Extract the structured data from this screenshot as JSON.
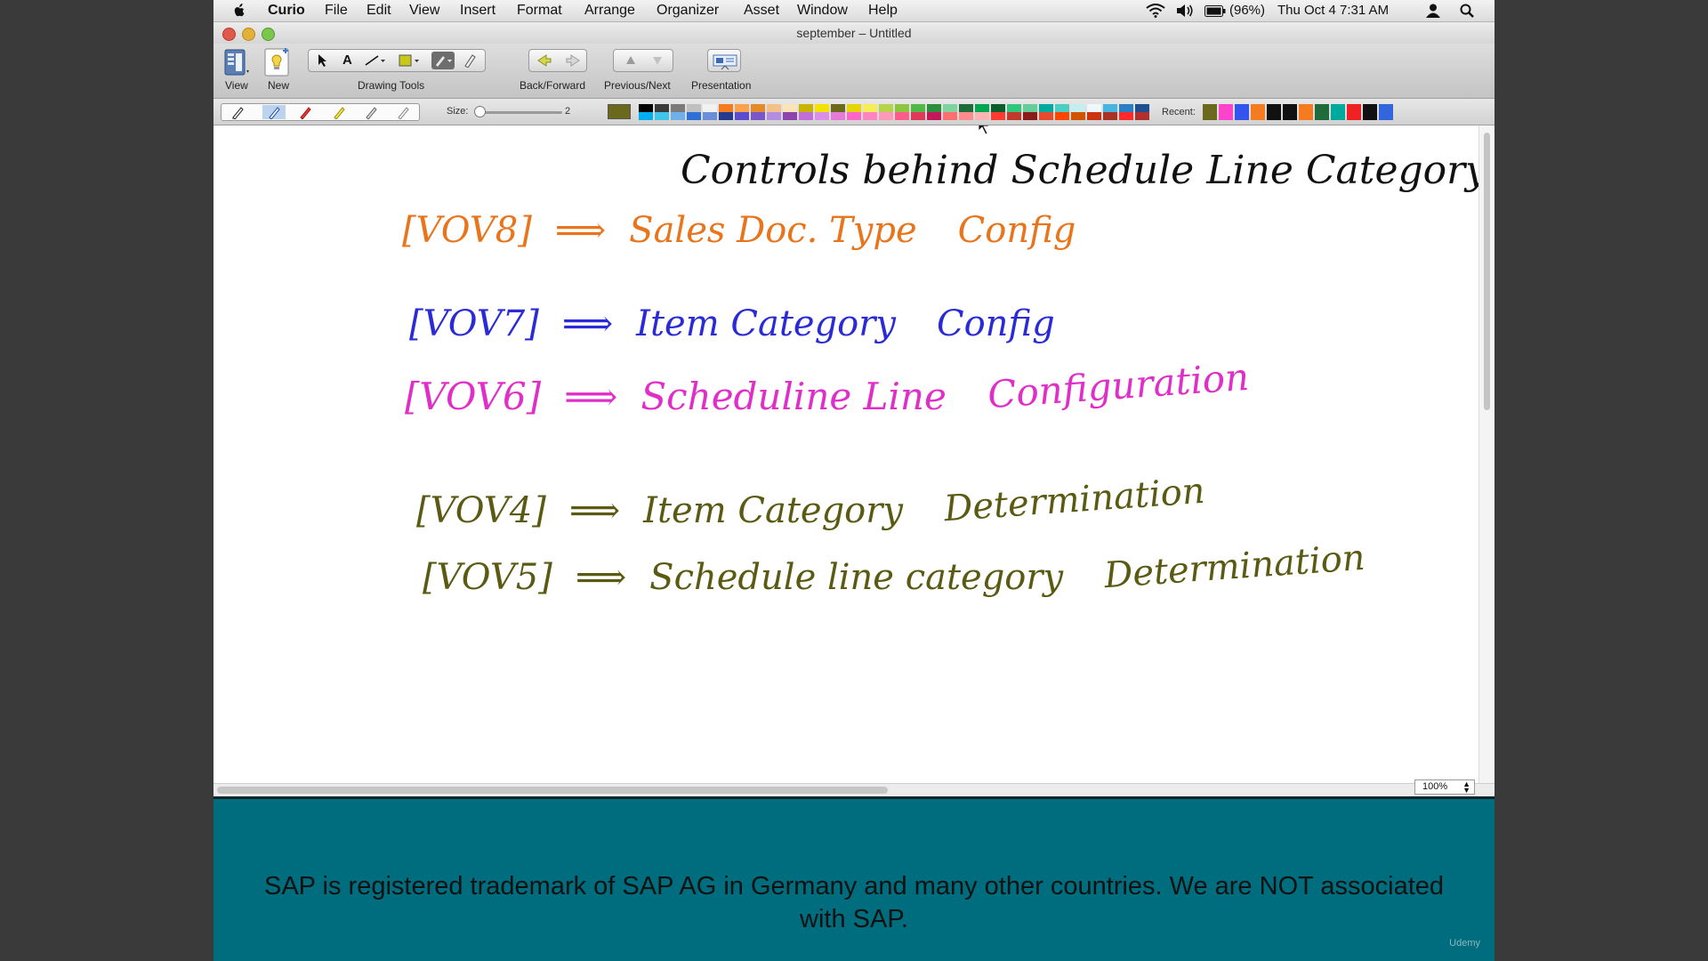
{
  "menubar": {
    "app_name": "Curio",
    "items": [
      "File",
      "Edit",
      "View",
      "Insert",
      "Format",
      "Arrange",
      "Organizer",
      "Asset",
      "Window",
      "Help"
    ],
    "battery": "(96%)",
    "clock": "Thu Oct 4  7:31 AM"
  },
  "window": {
    "title": "september – Untitled"
  },
  "toolbar": {
    "view_label": "View",
    "new_label": "New",
    "drawing_tools_label": "Drawing Tools",
    "back_forward_label": "Back/Forward",
    "previous_next_label": "Previous/Next",
    "presentation_label": "Presentation",
    "text_tool_glyph": "A"
  },
  "palette": {
    "size_label": "Size:",
    "size_value": "2",
    "recent_label": "Recent:",
    "current_color": "#6b6a1c",
    "colors_top": [
      "#000000",
      "#3a3a3a",
      "#7a7a7a",
      "#c0c0c0",
      "#f2f2f2",
      "#f47b20",
      "#f9a24c",
      "#e38a2a",
      "#f4c089",
      "#fde4b8",
      "#c8b400",
      "#f2e200",
      "#6b6a1c",
      "#e6d600",
      "#f5ee59",
      "#b5d44c",
      "#8cc63f",
      "#52b848",
      "#2d8f3a",
      "#7fd3a0",
      "#1f6b3a",
      "#00a651",
      "#0b5d2c",
      "#30c67c",
      "#66cc99",
      "#00a99d",
      "#4ecdc4",
      "#c6eef0",
      "#f0f8ff",
      "#47b5e0",
      "#2b7ec1",
      "#1f4f8f"
    ],
    "colors_bottom": [
      "#00aeef",
      "#40c4ea",
      "#6fb0e8",
      "#2e6fd8",
      "#6a8fd6",
      "#233a8f",
      "#5a4bd1",
      "#7a57c8",
      "#b48ce0",
      "#8e44ad",
      "#c06fd8",
      "#d98fe8",
      "#e57ad8",
      "#ff66cc",
      "#ff85c0",
      "#ff99bb",
      "#ff5c8a",
      "#e03a5a",
      "#c2185b",
      "#ff6f6f",
      "#ff8c8c",
      "#ffb3b3",
      "#ff3b30",
      "#c0392b",
      "#8b1a1a",
      "#e84a2f",
      "#ff4500",
      "#d35400",
      "#cc3311",
      "#a93226",
      "#ff2a2a",
      "#b03030"
    ],
    "recent_colors": [
      "#6b6a1c",
      "#ff44cc",
      "#3355ee",
      "#f47b20",
      "#111111",
      "#111111",
      "#f47b20",
      "#1f6b3a",
      "#00a99d",
      "#ee2222",
      "#111111",
      "#3366dd"
    ]
  },
  "canvas": {
    "title": "Controls behind Schedule Line Category",
    "rows": [
      {
        "code": "[VOV8]",
        "arrow": "⟹",
        "text": "Sales Doc. Type",
        "extra": "Config",
        "color": "#e8741c"
      },
      {
        "code": "[VOV7]",
        "arrow": "⟹",
        "text": "Item Category",
        "extra": "Config",
        "color": "#2a2bd6"
      },
      {
        "code": "[VOV6]",
        "arrow": "⟹",
        "text": "Scheduline Line",
        "extra": "Configuration",
        "color": "#e02fc8"
      },
      {
        "code": "[VOV4]",
        "arrow": "⟹",
        "text": "Item Category",
        "extra": "Determination",
        "color": "#5a5a12"
      },
      {
        "code": "[VOV5]",
        "arrow": "⟹",
        "text": "Schedule line category",
        "extra": "Determination",
        "color": "#5a5a12"
      }
    ]
  },
  "statusbar": {
    "zoom": "100%"
  },
  "caption": {
    "text": "SAP is registered trademark of SAP AG in Germany and many other countries. We are NOT associated with SAP.",
    "brand": "Udemy"
  }
}
